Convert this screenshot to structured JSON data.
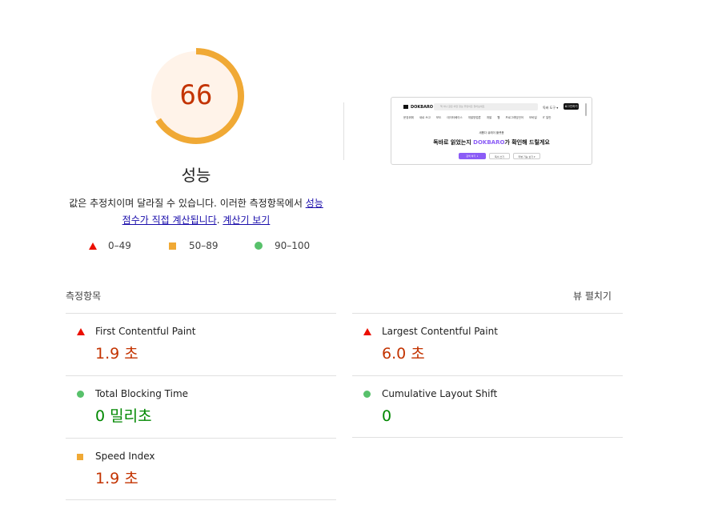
{
  "gauge": {
    "score": "66",
    "fraction": 0.66,
    "color": "#f0a935",
    "bg": "#fff3e9",
    "text_color": "#c33300"
  },
  "category": {
    "title": "성능"
  },
  "description": {
    "text": "값은 추정치이며 달라질 수 있습니다. 이러한 측정항목에서 ",
    "link1": "성능 점수가 직접 계산됩니다",
    "mid": ". ",
    "link2": "계산기 보기"
  },
  "legend": {
    "fail": "0–49",
    "average": "50–89",
    "pass": "90–100"
  },
  "screenshot": {
    "logo": "DOKBARO",
    "search_placeholder": "책 이나 글은 어떤 정보 무엇이든 찾아보세요",
    "guide": "독바 도구 ▾",
    "login": "로그인하기",
    "nav": [
      "문장위에",
      "새로 쓰고",
      "보도",
      "데이터베이스",
      "개발방법론",
      "개발",
      "웹",
      "프로그래밍언어",
      "모바일",
      "IT 일반"
    ],
    "subheading": "새롭다 큐레이 플랫폼",
    "heading_pre": "독바로 읽었는지 ",
    "heading_brand": "DOKBARO",
    "heading_post": "가 확인해 드릴게요",
    "buttons": [
      "검색 하기 ↓",
      "독서 쓰기",
      "리뷰 기능 보기 ▾"
    ]
  },
  "metrics_header": "측정항목",
  "expand_label": "뷰 펼치기",
  "metrics": [
    {
      "title": "First Contentful Paint",
      "value": "1.9 초",
      "status": "fail"
    },
    {
      "title": "Largest Contentful Paint",
      "value": "6.0 초",
      "status": "fail"
    },
    {
      "title": "Total Blocking Time",
      "value": "0 밀리초",
      "status": "pass"
    },
    {
      "title": "Cumulative Layout Shift",
      "value": "0",
      "status": "pass"
    },
    {
      "title": "Speed Index",
      "value": "1.9 초",
      "status": "average"
    }
  ]
}
